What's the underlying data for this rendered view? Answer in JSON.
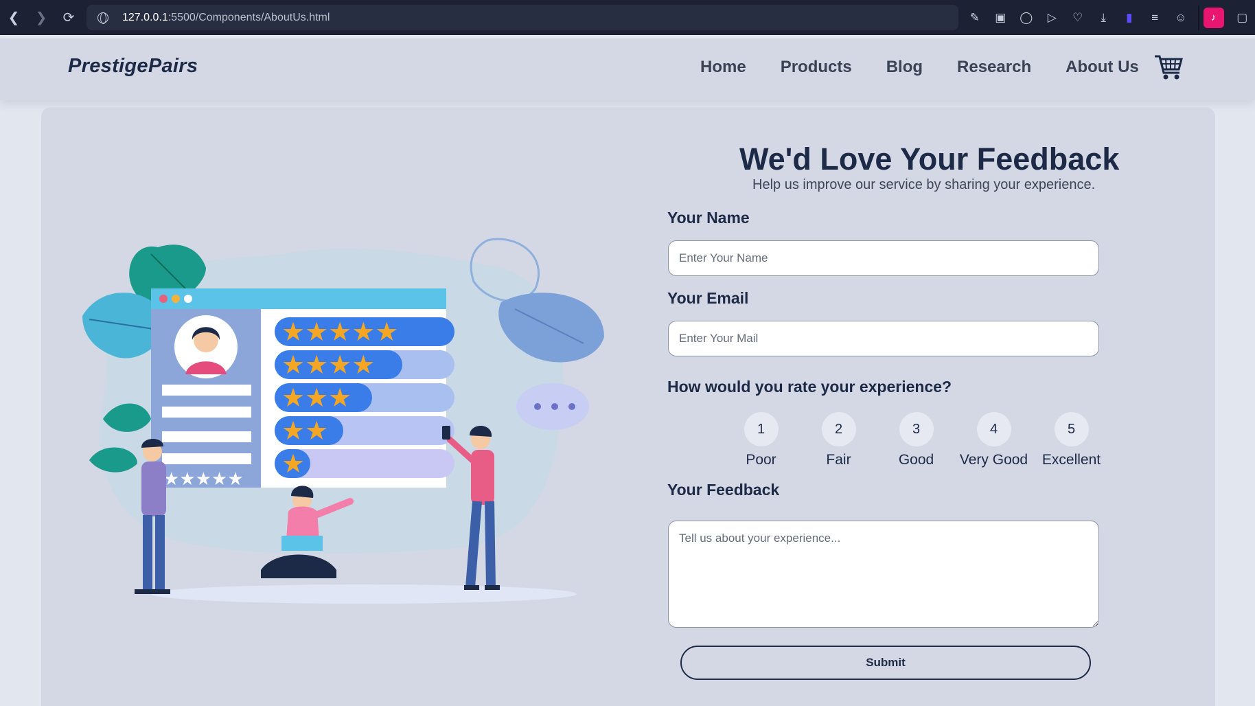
{
  "browser": {
    "url_host": "127.0.0.1",
    "url_path": ":5500/Components/AboutUs.html",
    "back_icon": "chevron-left-icon",
    "forward_icon": "chevron-right-icon",
    "reload_icon": "reload-icon",
    "toolbar_icons": [
      "edit-icon",
      "camera-icon",
      "shield-icon",
      "play-icon",
      "heart-icon",
      "download-icon",
      "extension-icon",
      "menu-icon",
      "account-icon"
    ]
  },
  "header": {
    "brand": "PrestigePairs",
    "nav": [
      "Home",
      "Products",
      "Blog",
      "Research",
      "About Us"
    ],
    "cart_icon": "cart-icon"
  },
  "feedback": {
    "title": "We'd Love Your Feedback",
    "subtitle": "Help us improve our service by sharing your experience.",
    "name_label": "Your Name",
    "name_placeholder": "Enter Your Name",
    "email_label": "Your Email",
    "email_placeholder": "Enter Your Mail",
    "rating_label": "How would you rate your experience?",
    "ratings": [
      {
        "num": "1",
        "label": "Poor"
      },
      {
        "num": "2",
        "label": "Fair"
      },
      {
        "num": "3",
        "label": "Good"
      },
      {
        "num": "4",
        "label": "Very Good"
      },
      {
        "num": "5",
        "label": "Excellent"
      }
    ],
    "feedback_label": "Your Feedback",
    "feedback_placeholder": "Tell us about your experience...",
    "submit_label": "Submit"
  },
  "colors": {
    "navy": "#1d2a47",
    "panel": "#d3d8e4",
    "page": "#e2e6ef",
    "chrome": "#1c2233",
    "star": "#f5a623",
    "bar_blue": "#3a7de8"
  }
}
